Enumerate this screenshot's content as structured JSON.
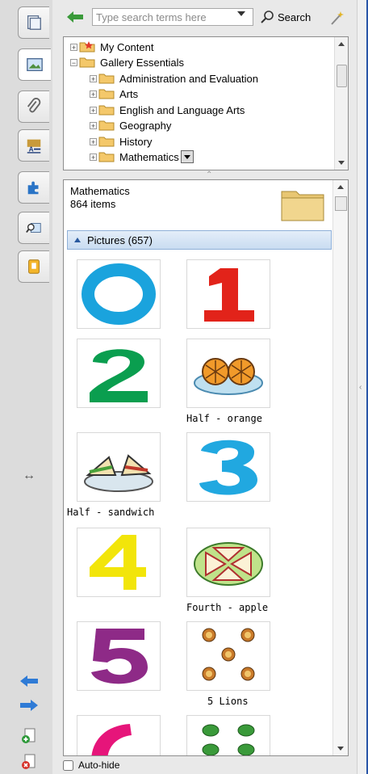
{
  "search": {
    "placeholder": "Type search terms here",
    "button_label": "Search"
  },
  "tree": {
    "items": [
      {
        "label": "My Content",
        "expander": "+"
      },
      {
        "label": "Gallery Essentials",
        "expander": "−"
      },
      {
        "label": "Administration and Evaluation",
        "expander": "+"
      },
      {
        "label": "Arts",
        "expander": "+"
      },
      {
        "label": "English and Language Arts",
        "expander": "+"
      },
      {
        "label": "Geography",
        "expander": "+"
      },
      {
        "label": "History",
        "expander": "+"
      },
      {
        "label": "Mathematics",
        "expander": "+"
      }
    ]
  },
  "category": {
    "name": "Mathematics",
    "count": "864 items"
  },
  "group": {
    "label": "Pictures (657)"
  },
  "thumbnails": [
    {
      "label": "",
      "icon": "digit-0"
    },
    {
      "label": "",
      "icon": "digit-1"
    },
    {
      "label": "",
      "icon": "digit-2"
    },
    {
      "label": "Half - orange",
      "icon": "orange-halves"
    },
    {
      "label": "Half - sandwich",
      "icon": "sandwich-halves"
    },
    {
      "label": "",
      "icon": "digit-3"
    },
    {
      "label": "",
      "icon": "digit-4"
    },
    {
      "label": "Fourth - apple",
      "icon": "apple-fourths"
    },
    {
      "label": "",
      "icon": "digit-5"
    },
    {
      "label": "5 Lions",
      "icon": "lions"
    },
    {
      "label": "",
      "icon": "digit-6"
    },
    {
      "label": "",
      "icon": "frogs"
    }
  ],
  "autohide": {
    "label": "Auto-hide",
    "checked": false
  },
  "colors": {
    "digit0": "#1aa3dd",
    "digit1": "#e2231a",
    "digit2": "#0a9e4f",
    "digit3": "#21a8e0",
    "digit4": "#f2e50a",
    "digit5": "#8e2a87",
    "digit6": "#e6157a",
    "group_header": "#c9dcf1"
  }
}
